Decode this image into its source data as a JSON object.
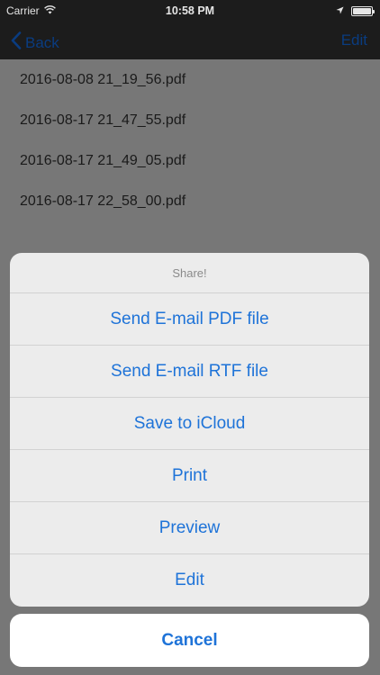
{
  "status_bar": {
    "carrier": "Carrier",
    "time": "10:58 PM",
    "icons": [
      "wifi-icon",
      "location-icon",
      "battery-icon"
    ],
    "battery_level": 1.0
  },
  "nav": {
    "back_label": "Back",
    "edit_label": "Edit"
  },
  "files": [
    "2016-08-08 21_19_56.pdf",
    "2016-08-17 21_47_55.pdf",
    "2016-08-17 21_49_05.pdf",
    "2016-08-17 22_58_00.pdf"
  ],
  "action_sheet": {
    "title": "Share!",
    "actions": [
      "Send E-mail PDF file",
      "Send E-mail RTF file",
      "Save to iCloud",
      "Print",
      "Preview",
      "Edit"
    ],
    "cancel_label": "Cancel"
  },
  "colors": {
    "accent": "#1e73d8",
    "dimmed_nav_tint": "#0a3c80",
    "overlay": "#777777",
    "sheet_bg": "#ececec"
  }
}
